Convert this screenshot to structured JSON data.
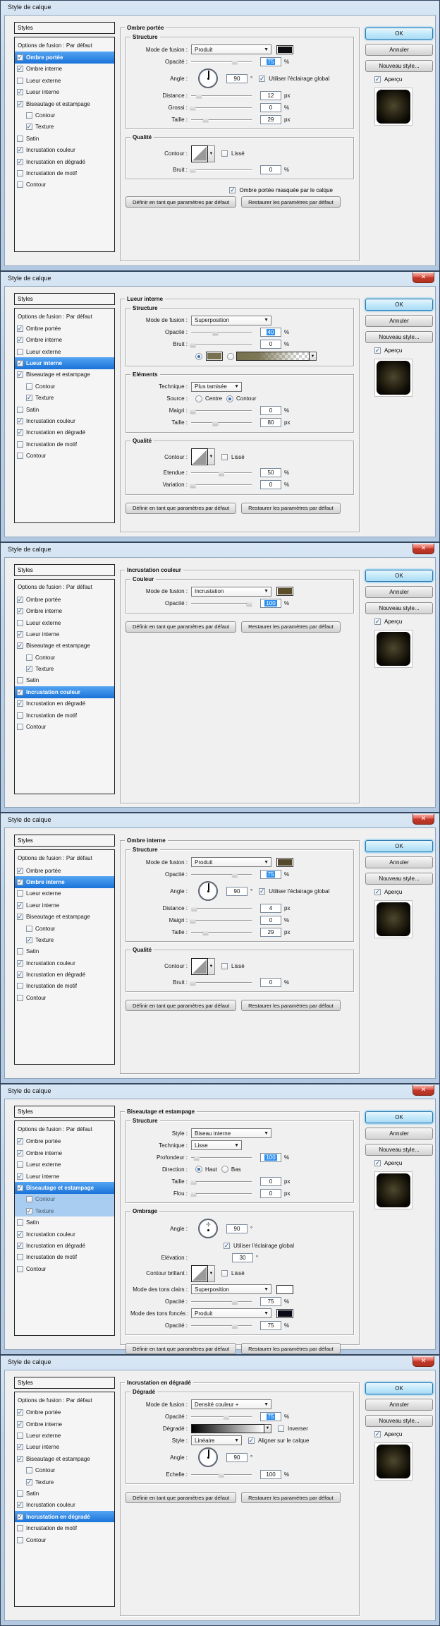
{
  "window_title": "Style de calque",
  "icons": {
    "close": "✕",
    "dropdown": "▼",
    "check": "✓"
  },
  "colors": {
    "selection_blue": "#1a73d9",
    "sub_selection_blue": "#a9cdf0",
    "titlebar": "#c0d4e9",
    "close_red": "#c23a2b",
    "client_bg": "#f0f0f0"
  },
  "sidebar": {
    "styles_label": "Styles",
    "blending_label": "Options de fusion : Par défaut",
    "items": [
      {
        "label": "Ombre portée",
        "checked": true,
        "indent": false
      },
      {
        "label": "Ombre interne",
        "checked": true,
        "indent": false
      },
      {
        "label": "Lueur externe",
        "checked": false,
        "indent": false
      },
      {
        "label": "Lueur interne",
        "checked": true,
        "indent": false
      },
      {
        "label": "Biseautage et estampage",
        "checked": true,
        "indent": false
      },
      {
        "label": "Contour",
        "checked": false,
        "indent": true
      },
      {
        "label": "Texture",
        "checked": true,
        "indent": true
      },
      {
        "label": "Satin",
        "checked": false,
        "indent": false
      },
      {
        "label": "Incrustation couleur",
        "checked": true,
        "indent": false
      },
      {
        "label": "Incrustation en dégradé",
        "checked": true,
        "indent": false
      },
      {
        "label": "Incrustation de motif",
        "checked": false,
        "indent": false
      },
      {
        "label": "Contour",
        "checked": false,
        "indent": false
      }
    ]
  },
  "right_panel": {
    "ok": "OK",
    "cancel": "Annuler",
    "new_style": "Nouveau style...",
    "preview": "Aperçu"
  },
  "footer_buttons": {
    "set_default": "Définir en tant que paramètres par défaut",
    "reset_default": "Restaurer les paramètres par défaut"
  },
  "dialogs": [
    {
      "panel_title": "Ombre portée",
      "selected": 0,
      "sub_selected": [],
      "close_button": false,
      "groups": [
        {
          "title": "Structure",
          "rows": [
            {
              "t": "dropdown",
              "label": "Mode de fusion :",
              "value": "Produit",
              "swatch": "#0d0d12"
            },
            {
              "t": "slider",
              "label": "Opacité :",
              "value": "75",
              "unit": "%",
              "pos": 72,
              "hl": true
            },
            {
              "t": "dial",
              "label": "Angle :",
              "value": "90",
              "unit": "°",
              "check": {
                "label": "Utiliser l'éclairage global",
                "checked": true
              }
            },
            {
              "t": "slider",
              "label": "Distance :",
              "value": "12",
              "unit": "px",
              "pos": 13
            },
            {
              "t": "slider",
              "label": "Grossi :",
              "value": "0",
              "unit": "%",
              "pos": 3
            },
            {
              "t": "slider",
              "label": "Taille :",
              "value": "29",
              "unit": "px",
              "pos": 24
            }
          ]
        },
        {
          "title": "Qualité",
          "rows": [
            {
              "t": "contour",
              "label": "Contour :",
              "lisse": "Lissé",
              "lisse_checked": false
            },
            {
              "t": "slider",
              "label": "Bruit :",
              "value": "0",
              "unit": "%",
              "pos": 3
            }
          ]
        }
      ],
      "footer_note": {
        "label": "Ombre portée masquée par le calque",
        "checked": true
      }
    },
    {
      "panel_title": "Lueur interne",
      "selected": 3,
      "sub_selected": [],
      "close_button": true,
      "groups": [
        {
          "title": "Structure",
          "rows": [
            {
              "t": "dropdown",
              "label": "Mode de fusion :",
              "value": "Superposition"
            },
            {
              "t": "slider",
              "label": "Opacité :",
              "value": "40",
              "unit": "%",
              "pos": 40,
              "hl": true
            },
            {
              "t": "slider",
              "label": "Bruit :",
              "value": "0",
              "unit": "%",
              "pos": 3
            },
            {
              "t": "colorpick",
              "swatch": "#77714f"
            }
          ]
        },
        {
          "title": "Eléments",
          "rows": [
            {
              "t": "dropdown",
              "label": "Technique :",
              "value": "Plus tamisée",
              "narrow": true
            },
            {
              "t": "radios",
              "label": "Source :",
              "options": [
                {
                  "label": "Centre",
                  "sel": false
                },
                {
                  "label": "Contour",
                  "sel": true
                }
              ]
            },
            {
              "t": "slider",
              "label": "Maigri :",
              "value": "0",
              "unit": "%",
              "pos": 3
            },
            {
              "t": "slider",
              "label": "Taille :",
              "value": "80",
              "unit": "px",
              "pos": 40
            }
          ]
        },
        {
          "title": "Qualité",
          "rows": [
            {
              "t": "contour",
              "label": "Contour :",
              "lisse": "Lissé",
              "lisse_checked": false
            },
            {
              "t": "slider",
              "label": "Etendue :",
              "value": "50",
              "unit": "%",
              "pos": 50
            },
            {
              "t": "slider",
              "label": "Variation :",
              "value": "0",
              "unit": "%",
              "pos": 3
            }
          ]
        }
      ]
    },
    {
      "panel_title": "Incrustation couleur",
      "selected": 8,
      "sub_selected": [],
      "close_button": true,
      "groups": [
        {
          "title": "Couleur",
          "rows": [
            {
              "t": "dropdown",
              "label": "Mode de fusion :",
              "value": "Incrustation",
              "swatch": "#5c4e2a"
            },
            {
              "t": "slider",
              "label": "Opacité :",
              "value": "100",
              "unit": "%",
              "pos": 96,
              "hl": true
            }
          ]
        }
      ]
    },
    {
      "panel_title": "Ombre interne",
      "selected": 1,
      "sub_selected": [],
      "close_button": true,
      "groups": [
        {
          "title": "Structure",
          "rows": [
            {
              "t": "dropdown",
              "label": "Mode de fusion :",
              "value": "Produit",
              "swatch": "#55492b"
            },
            {
              "t": "slider",
              "label": "Opacité :",
              "value": "75",
              "unit": "%",
              "pos": 72,
              "hl": true
            },
            {
              "t": "dial",
              "label": "Angle :",
              "value": "90",
              "unit": "°",
              "check": {
                "label": "Utiliser l'éclairage global",
                "checked": true
              }
            },
            {
              "t": "slider",
              "label": "Distance :",
              "value": "4",
              "unit": "px",
              "pos": 5
            },
            {
              "t": "slider",
              "label": "Maigri :",
              "value": "0",
              "unit": "%",
              "pos": 3
            },
            {
              "t": "slider",
              "label": "Taille :",
              "value": "29",
              "unit": "px",
              "pos": 24
            }
          ]
        },
        {
          "title": "Qualité",
          "rows": [
            {
              "t": "contour",
              "label": "Contour :",
              "lisse": "Lissé",
              "lisse_checked": false
            },
            {
              "t": "slider",
              "label": "Bruit :",
              "value": "0",
              "unit": "%",
              "pos": 3
            }
          ]
        }
      ]
    },
    {
      "panel_title": "Biseautage et estampage",
      "selected": 4,
      "sub_selected": [
        5,
        6
      ],
      "close_button": true,
      "groups": [
        {
          "title": "Structure",
          "rows": [
            {
              "t": "dropdown",
              "label": "Style :",
              "value": "Biseau interne"
            },
            {
              "t": "dropdown",
              "label": "Technique :",
              "value": "Lisse",
              "narrow": true
            },
            {
              "t": "slider",
              "label": "Profondeur :",
              "value": "100",
              "unit": "%",
              "pos": 9,
              "hl": true
            },
            {
              "t": "radios",
              "label": "Direction :",
              "options": [
                {
                  "label": "Haut",
                  "sel": true
                },
                {
                  "label": "Bas",
                  "sel": false
                }
              ]
            },
            {
              "t": "slider",
              "label": "Taille :",
              "value": "0",
              "unit": "px",
              "pos": 4
            },
            {
              "t": "slider",
              "label": "Flou :",
              "value": "0",
              "unit": "px",
              "pos": 4
            }
          ]
        },
        {
          "title": "Ombrage",
          "rows": [
            {
              "t": "dial",
              "label": "Angle :",
              "value": "90",
              "unit": "°",
              "variant": "cross",
              "stack_check": {
                "label": "Utiliser l'éclairage global",
                "checked": true
              }
            },
            {
              "t": "valuebox",
              "label": "Elévation :",
              "value": "30",
              "unit": "°"
            },
            {
              "t": "contour",
              "label": "Contour brillant :",
              "lisse": "Lissé",
              "lisse_checked": false
            },
            {
              "t": "dropdown",
              "label": "Mode des tons clairs :",
              "value": "Superposition",
              "swatch": "#ffffff"
            },
            {
              "t": "slider",
              "label": "Opacité :",
              "value": "75",
              "unit": "%",
              "pos": 72
            },
            {
              "t": "dropdown",
              "label": "Mode des tons foncés :",
              "value": "Produit",
              "swatch": "#0a0a18"
            },
            {
              "t": "slider",
              "label": "Opacité :",
              "value": "75",
              "unit": "%",
              "pos": 72
            }
          ]
        }
      ]
    },
    {
      "panel_title": "Incrustation en dégradé",
      "selected": 9,
      "sub_selected": [],
      "close_button": true,
      "groups": [
        {
          "title": "Dégradé",
          "rows": [
            {
              "t": "dropdown",
              "label": "Mode de fusion :",
              "value": "Densité couleur +"
            },
            {
              "t": "slider",
              "label": "Opacité :",
              "value": "75",
              "unit": "%",
              "pos": 58,
              "hl": true
            },
            {
              "t": "gradientrow",
              "label": "Dégradé :",
              "check": {
                "label": "Inverser",
                "checked": false
              }
            },
            {
              "t": "dropdown",
              "label": "Style :",
              "value": "Linéaire",
              "narrow": true,
              "check": {
                "label": "Aligner sur le calque",
                "checked": true
              }
            },
            {
              "t": "dial",
              "label": "Angle :",
              "value": "90",
              "unit": "°"
            },
            {
              "t": "slider",
              "label": "Echelle :",
              "value": "100",
              "unit": "%",
              "pos": 50
            }
          ]
        }
      ]
    }
  ]
}
